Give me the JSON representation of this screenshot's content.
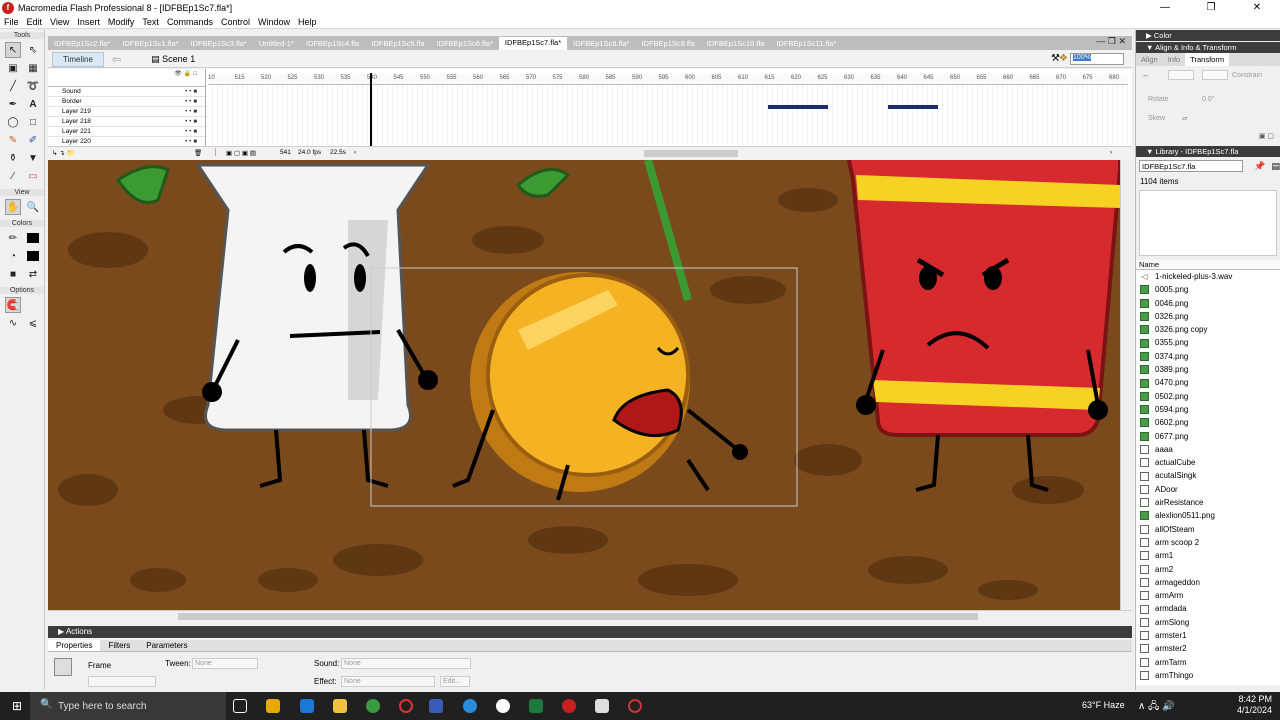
{
  "window": {
    "title": "Macromedia Flash Professional 8 - [IDFBEp1Sc7.fla*]",
    "app_icon": "flash-icon"
  },
  "menu": [
    "File",
    "Edit",
    "View",
    "Insert",
    "Modify",
    "Text",
    "Commands",
    "Control",
    "Window",
    "Help"
  ],
  "tools": {
    "label": "Tools",
    "view_label": "View",
    "colors_label": "Colors",
    "options_label": "Options"
  },
  "doc_tabs": [
    "IDFBEp1Sc2.fla*",
    "IDFBEp1Sc1.fla*",
    "IDFBEp1Sc3.fla*",
    "Untitled-1*",
    "IDFBEp1Sc4.fla",
    "IDFBEp1Sc5.fla",
    "IDFBEp1Sc6.fla*",
    "IDFBEp1Sc7.fla*",
    "IDFBEp1Sc8.fla*",
    "IDFBEp1Sc9.fla",
    "IDFBEp1Sc10.fla",
    "IDFBEp1Sc11.fla*"
  ],
  "active_tab_index": 7,
  "timeline": {
    "toggle": "Timeline",
    "scene": "Scene 1",
    "zoom": "100%",
    "ruler": [
      "10",
      "515",
      "520",
      "525",
      "530",
      "535",
      "540",
      "545",
      "550",
      "555",
      "560",
      "565",
      "570",
      "575",
      "580",
      "585",
      "590",
      "595",
      "600",
      "605",
      "610",
      "615",
      "620",
      "625",
      "630",
      "635",
      "640",
      "645",
      "650",
      "655",
      "660",
      "665",
      "670",
      "675",
      "680",
      "68"
    ],
    "layers": [
      "Sound",
      "Border",
      "Layer 219",
      "Layer 218",
      "Layer 221",
      "Layer 220"
    ],
    "current_frame": "541",
    "fps": "24.0 fps",
    "time": "22.5s"
  },
  "panels": {
    "actions": "Actions",
    "props_tabs": [
      "Properties",
      "Filters",
      "Parameters"
    ],
    "frame_label": "Frame",
    "tween_label": "Tween:",
    "tween_value": "None",
    "sound_label": "Sound:",
    "sound_value": "None",
    "effect_label": "Effect:",
    "effect_value": "None",
    "edit_btn": "Edit..."
  },
  "right_panel": {
    "color_header": "Color",
    "align_header": "Align & Info & Transform",
    "align_tabs": [
      "Align",
      "Info",
      "Transform"
    ],
    "constrain": "Constrain",
    "rotate": "Rotate",
    "rotate_val": "0.0°",
    "skew": "Skew",
    "library_header": "Library - IDFBEp1Sc7.fla",
    "library_select": "IDFBEp1Sc7.fla",
    "item_count": "1104 items",
    "name_col": "Name",
    "items": [
      {
        "name": "1-nickeled-plus-3.wav",
        "type": "snd"
      },
      {
        "name": "0005.png",
        "type": "bmp"
      },
      {
        "name": "0046.png",
        "type": "bmp"
      },
      {
        "name": "0326.png",
        "type": "bmp"
      },
      {
        "name": "0326.png copy",
        "type": "bmp"
      },
      {
        "name": "0355.png",
        "type": "bmp"
      },
      {
        "name": "0374.png",
        "type": "bmp"
      },
      {
        "name": "0389.png",
        "type": "bmp"
      },
      {
        "name": "0470.png",
        "type": "bmp"
      },
      {
        "name": "0502.png",
        "type": "bmp"
      },
      {
        "name": "0594.png",
        "type": "bmp"
      },
      {
        "name": "0602.png",
        "type": "bmp"
      },
      {
        "name": "0677.png",
        "type": "bmp"
      },
      {
        "name": "aaaa",
        "type": "sym"
      },
      {
        "name": "actualCube",
        "type": "sym"
      },
      {
        "name": "acutalSingk",
        "type": "sym"
      },
      {
        "name": "ADoor",
        "type": "sym"
      },
      {
        "name": "airResistance",
        "type": "sym"
      },
      {
        "name": "alexlion0511.png",
        "type": "bmp"
      },
      {
        "name": "allOfSteam",
        "type": "sym"
      },
      {
        "name": "arm scoop 2",
        "type": "sym"
      },
      {
        "name": "arm1",
        "type": "sym"
      },
      {
        "name": "arm2",
        "type": "sym"
      },
      {
        "name": "armageddon",
        "type": "sym"
      },
      {
        "name": "armArm",
        "type": "sym"
      },
      {
        "name": "armdada",
        "type": "sym"
      },
      {
        "name": "armSlong",
        "type": "sym"
      },
      {
        "name": "armster1",
        "type": "sym"
      },
      {
        "name": "armster2",
        "type": "sym"
      },
      {
        "name": "armTarm",
        "type": "sym"
      },
      {
        "name": "armThingo",
        "type": "sym"
      }
    ]
  },
  "taskbar": {
    "search_placeholder": "Type here to search",
    "weather": "63°F Haze",
    "time": "8:42 PM",
    "date": "4/1/2024"
  }
}
